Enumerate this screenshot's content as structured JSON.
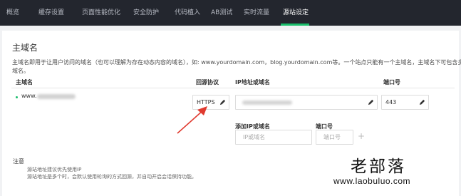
{
  "nav": {
    "tabs": [
      {
        "label": "概览"
      },
      {
        "label": "缓存设置"
      },
      {
        "label": "页面性能优化"
      },
      {
        "label": "安全防护"
      },
      {
        "label": "代码植入"
      },
      {
        "label": "AB测试"
      },
      {
        "label": "实时流量"
      },
      {
        "label": "源站设定"
      }
    ],
    "active_index": 7
  },
  "section": {
    "title": "主域名",
    "desc_line1": "主域名即用于让用户访问的域名（也可以理解为存在动态内容的域名），如: www.yourdomain.com，blog.yourdomain.com等。一个站点只能有一个主域名，主域名下可包含多个资源",
    "desc_line2": "域名。"
  },
  "table": {
    "headers": {
      "domain": "主域名",
      "protocol": "回源协议",
      "ip": "IP地址或域名",
      "port": "端口号"
    },
    "row": {
      "domain_prefix": "www.",
      "protocol": "HTTPS",
      "port": "443"
    }
  },
  "add_origin": {
    "ip_label": "添加IP或域名",
    "ip_placeholder": "IP或域名",
    "port_label": "端口号",
    "port_placeholder": "端口号",
    "add_symbol": "+"
  },
  "notes": {
    "title": "注意",
    "line1": "源站地址建议优先使用IP",
    "line2": "源站地址是多个时，会默认使用轮询的方式回源，并自动开启会话保持功能。"
  },
  "watermark": {
    "cn": "老部落",
    "url": "www.laobuluo.com"
  },
  "colors": {
    "nav_bg": "#23262e",
    "accent": "#19be6b",
    "arrow": "#e03a2f"
  }
}
